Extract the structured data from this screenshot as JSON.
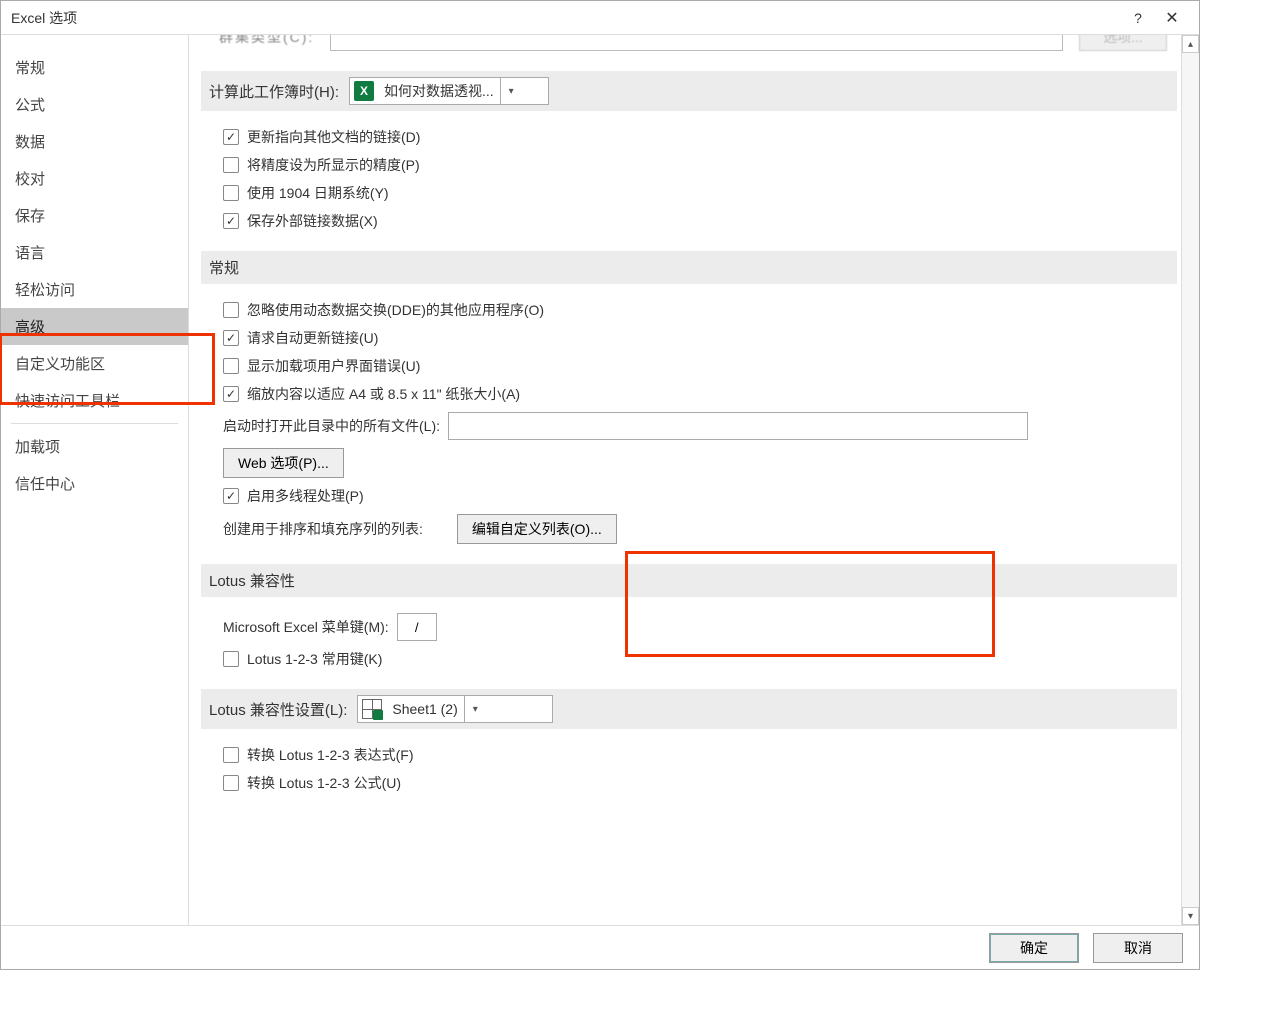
{
  "title": "Excel 选项",
  "help_glyph": "?",
  "close_glyph": "✕",
  "sidebar": {
    "items": [
      "常规",
      "公式",
      "数据",
      "校对",
      "保存",
      "语言",
      "轻松访问",
      "高级",
      "自定义功能区",
      "快速访问工具栏",
      "加载项",
      "信任中心"
    ],
    "selected": "高级"
  },
  "cutoff": {
    "label": "群集类型(C):",
    "btn": "选项..."
  },
  "calc": {
    "head": "计算此工作簿时(H):",
    "workbook": "如何对数据透视...",
    "opts": {
      "update_links": "更新指向其他文档的链接(D)",
      "precision": "将精度设为所显示的精度(P)",
      "date1904": "使用 1904 日期系统(Y)",
      "save_ext": "保存外部链接数据(X)"
    }
  },
  "general": {
    "head": "常规",
    "ignore_dde": "忽略使用动态数据交换(DDE)的其他应用程序(O)",
    "ask_update": "请求自动更新链接(U)",
    "show_addin_err": "显示加载项用户界面错误(U)",
    "scale_a4": "缩放内容以适应 A4 或 8.5 x 11\" 纸张大小(A)",
    "startup_label": "启动时打开此目录中的所有文件(L):",
    "web_options_btn": "Web 选项(P)...",
    "multithread": "启用多线程处理(P)",
    "custom_list_label": "创建用于排序和填充序列的列表:",
    "edit_custom_list_btn": "编辑自定义列表(O)..."
  },
  "lotus": {
    "head": "Lotus 兼容性",
    "menu_key_label": "Microsoft Excel 菜单键(M):",
    "menu_key_value": "/",
    "nav_keys": "Lotus 1-2-3 常用键(K)"
  },
  "lotus_settings": {
    "head": "Lotus 兼容性设置(L):",
    "sheet": "Sheet1 (2)",
    "eval_formulas": "转换 Lotus 1-2-3 表达式(F)",
    "enter_formulas": "转换 Lotus 1-2-3 公式(U)"
  },
  "footer": {
    "ok": "确定",
    "cancel": "取消"
  }
}
